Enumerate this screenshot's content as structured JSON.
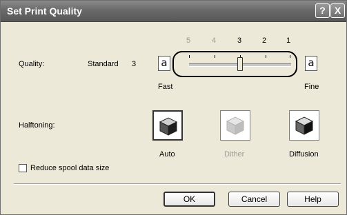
{
  "window": {
    "title": "Set Print Quality",
    "help_glyph": "?",
    "close_glyph": "X"
  },
  "quality": {
    "label": "Quality:",
    "value_text": "Standard",
    "value_number": "3",
    "ticks": [
      "5",
      "4",
      "3",
      "2",
      "1"
    ],
    "selected_level": 3,
    "low_label": "Fast",
    "high_label": "Fine",
    "glyph": "a"
  },
  "halftoning": {
    "label": "Halftoning:",
    "options": [
      {
        "label": "Auto",
        "icon": "auto-halftone-icon",
        "enabled": true,
        "selected": true
      },
      {
        "label": "Dither",
        "icon": "dither-halftone-icon",
        "enabled": false,
        "selected": false
      },
      {
        "label": "Diffusion",
        "icon": "diffusion-halftone-icon",
        "enabled": true,
        "selected": false
      }
    ]
  },
  "reduce_spool": {
    "label": "Reduce spool data size",
    "checked": false
  },
  "buttons": {
    "ok": "OK",
    "cancel": "Cancel",
    "help": "Help"
  },
  "colors": {
    "titlebar": "#6a6a6a",
    "dialog_bg": "#ece9d8",
    "disabled_text": "#9a9a9a"
  }
}
